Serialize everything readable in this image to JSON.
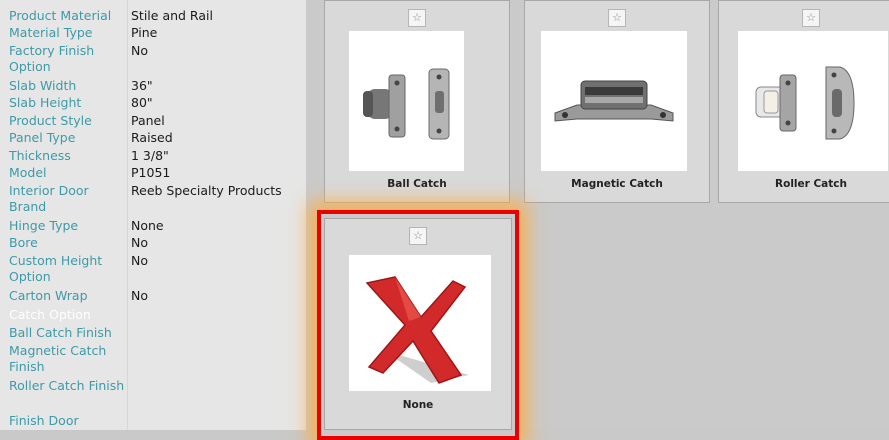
{
  "properties": [
    {
      "label": "Product Material",
      "value": "Stile and Rail"
    },
    {
      "label": "Material Type",
      "value": "Pine"
    },
    {
      "label": "Factory Finish Option",
      "value": "No"
    },
    {
      "label": "Slab Width",
      "value": "36\""
    },
    {
      "label": "Slab Height",
      "value": "80\""
    },
    {
      "label": "Product Style",
      "value": "Panel"
    },
    {
      "label": "Panel Type",
      "value": "Raised"
    },
    {
      "label": "Thickness",
      "value": "1 3/8\""
    },
    {
      "label": "Model",
      "value": "P1051"
    },
    {
      "label": "Interior Door Brand",
      "value": "Reeb Specialty Products"
    },
    {
      "label": "Hinge Type",
      "value": "None"
    },
    {
      "label": "Bore",
      "value": "No"
    },
    {
      "label": "Custom Height Option",
      "value": "No"
    },
    {
      "label": "Carton Wrap",
      "value": "No"
    },
    {
      "label": "Catch Option",
      "value": ""
    },
    {
      "label": "Ball Catch Finish",
      "value": ""
    },
    {
      "label": "Magnetic Catch Finish",
      "value": ""
    },
    {
      "label": "Roller Catch Finish",
      "value": ""
    },
    {
      "label": "Finish Door",
      "value": ""
    }
  ],
  "selected_property": "Catch Option",
  "tiles": [
    {
      "name": "Ball Catch",
      "icon": "ball-catch-image"
    },
    {
      "name": "Magnetic Catch",
      "icon": "magnetic-catch-image"
    },
    {
      "name": "Roller Catch",
      "icon": "roller-catch-image"
    },
    {
      "name": "None",
      "icon": "none-x-image"
    }
  ],
  "selected_tile": "None",
  "colors": {
    "label": "#3d9aa7",
    "highlight_row": "#ffc896",
    "selection_border": "#e90000",
    "none_x_red": "#d22a2a"
  },
  "star_glyph": "☆"
}
